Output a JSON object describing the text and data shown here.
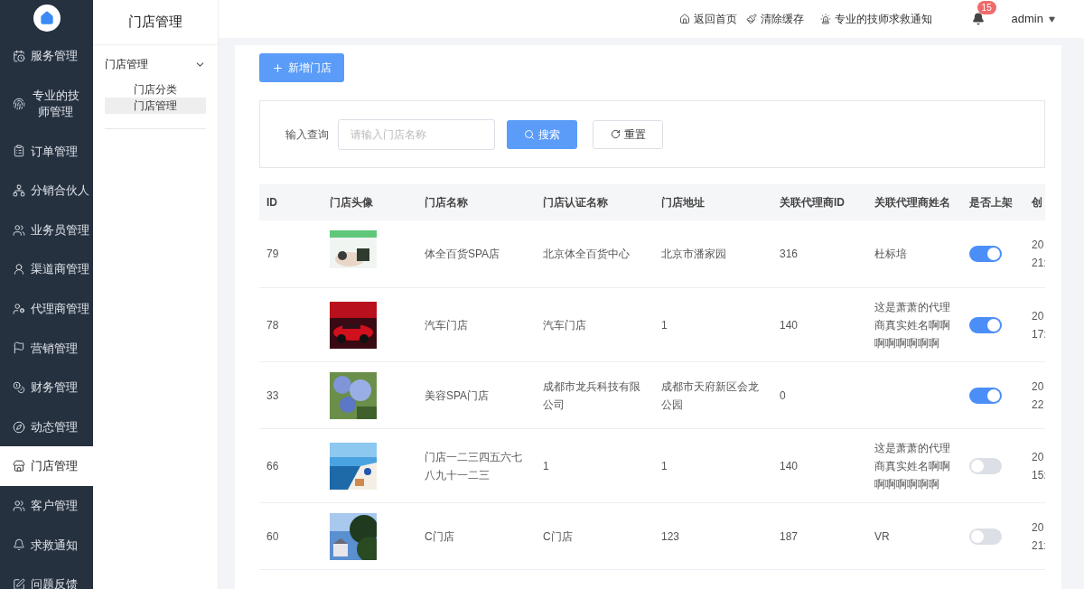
{
  "sidebar": {
    "items": [
      {
        "label": "服务管理",
        "selected": false
      },
      {
        "label": "专业的技师管理",
        "selected": false
      },
      {
        "label": "订单管理",
        "selected": false
      },
      {
        "label": "分销合伙人",
        "selected": false
      },
      {
        "label": "业务员管理",
        "selected": false
      },
      {
        "label": "渠道商管理",
        "selected": false
      },
      {
        "label": "代理商管理",
        "selected": false
      },
      {
        "label": "营销管理",
        "selected": false
      },
      {
        "label": "财务管理",
        "selected": false
      },
      {
        "label": "动态管理",
        "selected": false
      },
      {
        "label": "门店管理",
        "selected": true
      },
      {
        "label": "客户管理",
        "selected": false
      },
      {
        "label": "求救通知",
        "selected": false
      },
      {
        "label": "问题反馈",
        "selected": false
      }
    ]
  },
  "submenu": {
    "title": "门店管理",
    "group": {
      "label": "门店管理",
      "expanded": true,
      "children": [
        {
          "label": "门店分类",
          "selected": false
        },
        {
          "label": "门店管理",
          "selected": true
        }
      ]
    }
  },
  "header": {
    "links": [
      "返回首页",
      "清除缓存",
      "专业的技师求救通知"
    ],
    "notification_count": "15",
    "user": "admin"
  },
  "toolbar": {
    "add_button": "新增门店"
  },
  "search": {
    "label": "输入查询",
    "placeholder": "请输入门店名称",
    "search_button": "搜索",
    "reset_button": "重置"
  },
  "table": {
    "columns": [
      "ID",
      "门店头像",
      "门店名称",
      "门店认证名称",
      "门店地址",
      "关联代理商ID",
      "关联代理商姓名",
      "是否上架",
      "创"
    ],
    "rows": [
      {
        "id": "79",
        "name": "体全百货SPA店",
        "cert_name": "北京体全百货中心",
        "address": "北京市潘家园",
        "agent_id": "316",
        "agent_name": "杜标培",
        "on": true,
        "created": [
          "20",
          "21:"
        ]
      },
      {
        "id": "78",
        "name": "汽车门店",
        "cert_name": "汽车门店",
        "address": "1",
        "agent_id": "140",
        "agent_name": "这是萧萧的代理商真实姓名啊啊啊啊啊啊啊啊",
        "on": true,
        "created": [
          "20",
          "17:"
        ]
      },
      {
        "id": "33",
        "name": "美容SPA门店",
        "cert_name": "成都市龙兵科技有限公司",
        "address": "成都市天府新区会龙公园",
        "agent_id": "0",
        "on": true,
        "created": [
          "20",
          "22"
        ]
      },
      {
        "id": "66",
        "name": "门店一二三四五六七八九十一二三",
        "cert_name": "1",
        "address": "1",
        "agent_id": "140",
        "agent_name": "这是萧萧的代理商真实姓名啊啊啊啊啊啊啊啊",
        "on": false,
        "created": [
          "20",
          "15:"
        ]
      },
      {
        "id": "60",
        "name": "C门店",
        "cert_name": "C门店",
        "address": "123",
        "agent_id": "187",
        "agent_name": "VR",
        "on": false,
        "created": [
          "20",
          "21:"
        ]
      }
    ]
  }
}
